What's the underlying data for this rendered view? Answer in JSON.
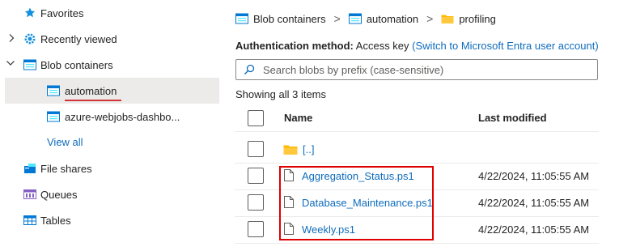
{
  "sidebar": {
    "favorites": "Favorites",
    "recently_viewed": "Recently viewed",
    "blob_containers": "Blob containers",
    "containers": [
      {
        "label": "automation"
      },
      {
        "label": "azure-webjobs-dashbo..."
      }
    ],
    "view_all": "View all",
    "file_shares": "File shares",
    "queues": "Queues",
    "tables": "Tables"
  },
  "breadcrumb": {
    "root": "Blob containers",
    "container": "automation",
    "folder": "profiling",
    "separator": ">"
  },
  "auth": {
    "label": "Authentication method:",
    "value": "Access key",
    "switch_link": "(Switch to Microsoft Entra user account)"
  },
  "search": {
    "placeholder": "Search blobs by prefix (case-sensitive)"
  },
  "list": {
    "count_text": "Showing all 3 items",
    "columns": {
      "name": "Name",
      "modified": "Last modified"
    },
    "parent_folder": "[..]",
    "rows": [
      {
        "name": "Aggregation_Status.ps1",
        "modified": "4/22/2024, 11:05:55 AM"
      },
      {
        "name": "Database_Maintenance.ps1",
        "modified": "4/22/2024, 11:05:55 AM"
      },
      {
        "name": "Weekly.ps1",
        "modified": "4/22/2024, 11:05:55 AM"
      }
    ]
  },
  "colors": {
    "link": "#0f6cbd",
    "selected_bg": "#edebe9",
    "highlight_red": "#e00000",
    "folder_yellow": "#ffb900"
  }
}
